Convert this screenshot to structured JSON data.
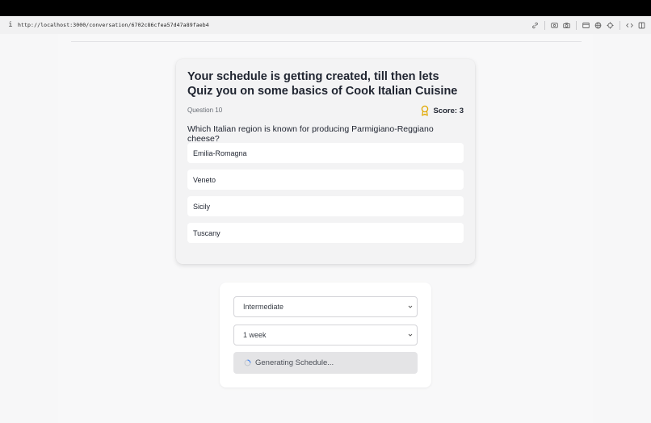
{
  "browser": {
    "url": "http://localhost:3000/conversation/6702c86cfea57d47a89faeb4",
    "info_icon": "i",
    "toolbar_icons": [
      "link-icon",
      "dollar-icon",
      "camera-icon",
      "window-icon",
      "globe-icon",
      "crosshair-icon",
      "code-icon",
      "split-view-icon"
    ]
  },
  "quiz": {
    "title": "Your schedule is getting created, till then lets Quiz you on some basics of Cook Italian Cuisine",
    "question_number": "Question 10",
    "score": "Score: 3",
    "question": "Which Italian region is known for producing Parmigiano-Reggiano cheese?",
    "options": [
      "Emilia-Romagna",
      "Veneto",
      "Sicily",
      "Tuscany"
    ]
  },
  "settings": {
    "level": "Intermediate",
    "duration": "1 week",
    "generate_label": "Generating Schedule..."
  },
  "colors": {
    "award_icon": "#e0a800",
    "spinner": "#3b82f6",
    "card_bg": "#f3f3f4",
    "button_disabled_bg": "#e4e4e6"
  }
}
